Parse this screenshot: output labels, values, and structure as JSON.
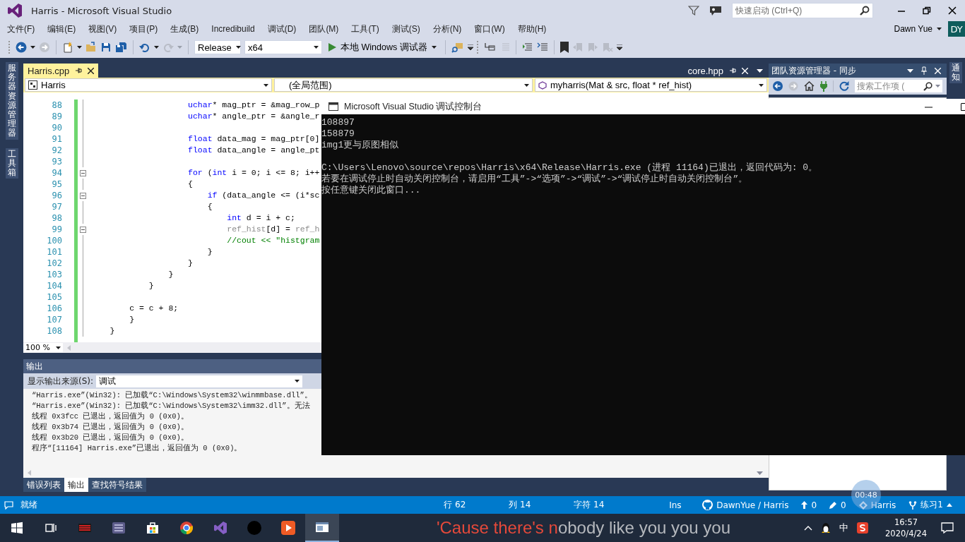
{
  "window": {
    "title": "Harris - Microsoft Visual Studio"
  },
  "quick_launch": {
    "placeholder": "快速启动 (Ctrl+Q)"
  },
  "menu": [
    "文件(F)",
    "编辑(E)",
    "视图(V)",
    "项目(P)",
    "生成(B)",
    "Incredibuild",
    "调试(D)",
    "团队(M)",
    "工具(T)",
    "测试(S)",
    "分析(N)",
    "窗口(W)",
    "帮助(H)"
  ],
  "account": {
    "name": "Dawn Yue",
    "initials": "DY"
  },
  "toolbar": {
    "configuration": "Release",
    "platform": "x64",
    "debugger": "本地 Windows 调试器"
  },
  "left_strip": [
    "服务器资源管理器",
    "工具箱"
  ],
  "right_strip": [
    "通知"
  ],
  "editor": {
    "tabs": [
      {
        "label": "Harris.cpp",
        "selected": true
      },
      {
        "label": "core.hpp",
        "selected": false
      }
    ],
    "nav": {
      "project": "Harris",
      "scope": "(全局范围)",
      "member": "myharris(Mat & src, float * ref_hist)"
    },
    "lines": [
      {
        "number": "88",
        "fold": false,
        "tokens": [
          {
            "kind": "keyword",
            "text": "                    uchar"
          },
          {
            "kind": "plain",
            "text": "* mag_ptr = &mag_row_p"
          }
        ]
      },
      {
        "number": "89",
        "fold": false,
        "tokens": [
          {
            "kind": "keyword",
            "text": "                    uchar"
          },
          {
            "kind": "plain",
            "text": "* angle_ptr = &angle_r"
          }
        ]
      },
      {
        "number": "90",
        "fold": false
      },
      {
        "number": "91",
        "fold": false,
        "tokens": [
          {
            "kind": "keyword",
            "text": "                    float"
          },
          {
            "kind": "plain",
            "text": " data_mag = mag_ptr[0]"
          }
        ]
      },
      {
        "number": "92",
        "fold": false,
        "tokens": [
          {
            "kind": "keyword",
            "text": "                    float"
          },
          {
            "kind": "plain",
            "text": " data_angle = angle_pt"
          }
        ]
      },
      {
        "number": "93",
        "fold": false
      },
      {
        "number": "94",
        "fold": true,
        "tokens": [
          {
            "kind": "keyword",
            "text": "                    for"
          },
          {
            "kind": "plain",
            "text": " ("
          },
          {
            "kind": "keyword",
            "text": "int"
          },
          {
            "kind": "plain",
            "text": " i = 0; i <= 8; i++"
          }
        ]
      },
      {
        "number": "95",
        "fold": false,
        "tokens": [
          {
            "kind": "plain",
            "text": "                    {"
          }
        ]
      },
      {
        "number": "96",
        "fold": true,
        "tokens": [
          {
            "kind": "keyword",
            "text": "                        if"
          },
          {
            "kind": "plain",
            "text": " (data_angle <= (i*sc"
          }
        ]
      },
      {
        "number": "97",
        "fold": false,
        "tokens": [
          {
            "kind": "plain",
            "text": "                        {"
          }
        ]
      },
      {
        "number": "98",
        "fold": false,
        "tokens": [
          {
            "kind": "keyword",
            "text": "                            int"
          },
          {
            "kind": "plain",
            "text": " d = i + c;"
          }
        ]
      },
      {
        "number": "99",
        "fold": true,
        "tokens": [
          {
            "kind": "faded",
            "text": "                            ref_hist"
          },
          {
            "kind": "plain",
            "text": "[d] = "
          },
          {
            "kind": "faded",
            "text": "ref_h"
          }
        ]
      },
      {
        "number": "100",
        "fold": false,
        "tokens": [
          {
            "kind": "comment",
            "text": "                            //cout << \"histgram"
          }
        ]
      },
      {
        "number": "101",
        "fold": false,
        "tokens": [
          {
            "kind": "plain",
            "text": "                        }"
          }
        ]
      },
      {
        "number": "102",
        "fold": false,
        "tokens": [
          {
            "kind": "plain",
            "text": "                    }"
          }
        ]
      },
      {
        "number": "103",
        "fold": false,
        "tokens": [
          {
            "kind": "plain",
            "text": "                }"
          }
        ]
      },
      {
        "number": "104",
        "fold": false,
        "tokens": [
          {
            "kind": "plain",
            "text": "            }"
          }
        ]
      },
      {
        "number": "105",
        "fold": false
      },
      {
        "number": "106",
        "fold": false,
        "tokens": [
          {
            "kind": "plain",
            "text": "        c = c + 8;"
          }
        ]
      },
      {
        "number": "107",
        "fold": false,
        "tokens": [
          {
            "kind": "plain",
            "text": "        }"
          }
        ]
      },
      {
        "number": "108",
        "fold": false,
        "tokens": [
          {
            "kind": "plain",
            "text": "    }"
          }
        ]
      }
    ],
    "zoom": "100 %"
  },
  "output": {
    "title": "输出",
    "source_label": "显示输出来源(S):",
    "source": "调试",
    "lines": [
      "“Harris.exe”(Win32): 已加载“C:\\Windows\\System32\\winmmbase.dll”。",
      "“Harris.exe”(Win32): 已加载“C:\\Windows\\System32\\imm32.dll”。无法",
      "线程 0x3fcc 已退出，返回值为 0 (0x0)。",
      "线程 0x3b74 已退出，返回值为 0 (0x0)。",
      "线程 0x3b20 已退出，返回值为 0 (0x0)。",
      "程序“[11164] Harris.exe”已退出，返回值为 0 (0x0)。"
    ],
    "tabs": [
      {
        "label": "错误列表",
        "selected": false
      },
      {
        "label": "输出",
        "selected": true
      },
      {
        "label": "查找符号结果",
        "selected": false
      }
    ]
  },
  "team_explorer": {
    "title": "团队资源管理器 - 同步",
    "search_placeholder": "搜索工作项 ("
  },
  "console": {
    "title": "Microsoft Visual Studio 调试控制台",
    "program_output": [
      "108897",
      "158879",
      "img1更与原图相似"
    ],
    "exit_messages": [
      "C:\\Users\\Lenovo\\source\\repos\\Harris\\x64\\Release\\Harris.exe (进程 11164)已退出，返回代码为: 0。",
      "若要在调试停止时自动关闭控制台，请启用“工具”->“选项”->“调试”->“调试停止时自动关闭控制台”。",
      "按任意键关闭此窗口..."
    ]
  },
  "status_bar": {
    "state": "就绪",
    "line": "行 62",
    "column": "列 14",
    "char": "字符 14",
    "mode": "Ins",
    "repo": "DawnYue / Harris",
    "unpushed": "0",
    "changes": "0",
    "project": "Harris",
    "branch": "练习1"
  },
  "recording_timer": "00:48",
  "taskbar": {
    "apps": [
      {
        "kind": "start",
        "selected": false
      },
      {
        "kind": "taskview",
        "selected": false
      },
      {
        "kind": "red",
        "selected": false
      },
      {
        "kind": "grid",
        "selected": false
      },
      {
        "kind": "store",
        "selected": false
      },
      {
        "kind": "browser",
        "selected": false
      },
      {
        "kind": "studio",
        "selected": false
      },
      {
        "kind": "circle",
        "selected": false
      },
      {
        "kind": "orange",
        "selected": false
      },
      {
        "kind": "console",
        "selected": true
      }
    ],
    "lyric": {
      "sung": "'Cause there's n",
      "unsung": "obody like you you you"
    },
    "ime": "中",
    "time": "16:57",
    "date": "2020/4/24"
  }
}
